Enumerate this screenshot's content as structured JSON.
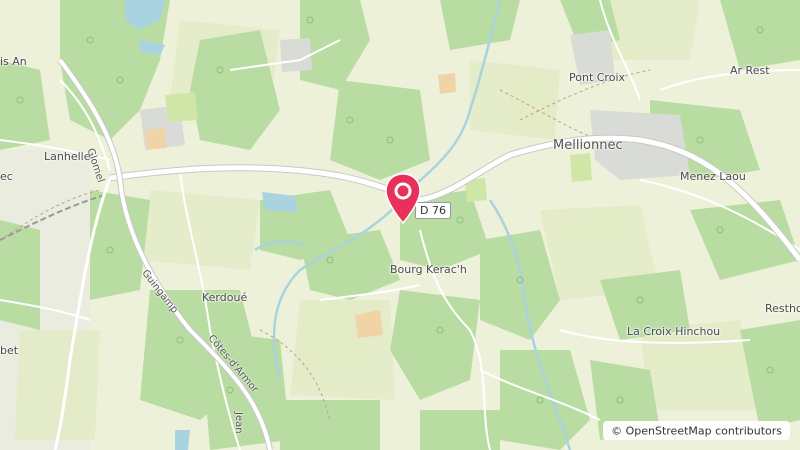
{
  "map": {
    "places": {
      "lanhelle": "Lanhelle",
      "kerdoue": "Kerdoué",
      "bourg_kerach": "Bourg Kerac'h",
      "mellionnec": "Mellionnec",
      "pont_croix": "Pont Croix",
      "ar_rest": "Ar Rest",
      "menez_laou": "Menez Laou",
      "la_croix_hinchou": "La Croix Hinchou",
      "resthou": "Resthou",
      "is_an": "is An",
      "ec": "ec",
      "bet": "bet"
    },
    "roads": {
      "d76": "D 76",
      "glomel": "Glomel",
      "guingamp": "Guingamp",
      "cotes_darmor": "Côtes-d'Armor",
      "jean": "Jean"
    },
    "attribution": {
      "symbol": "©",
      "text": "OpenStreetMap contributors"
    },
    "colors": {
      "land": "#eef1d9",
      "forest": "#b9dca3",
      "field": "#e3ebc6",
      "water": "#a9d3df",
      "road": "#ffffff",
      "marker": "#e8305b"
    }
  }
}
